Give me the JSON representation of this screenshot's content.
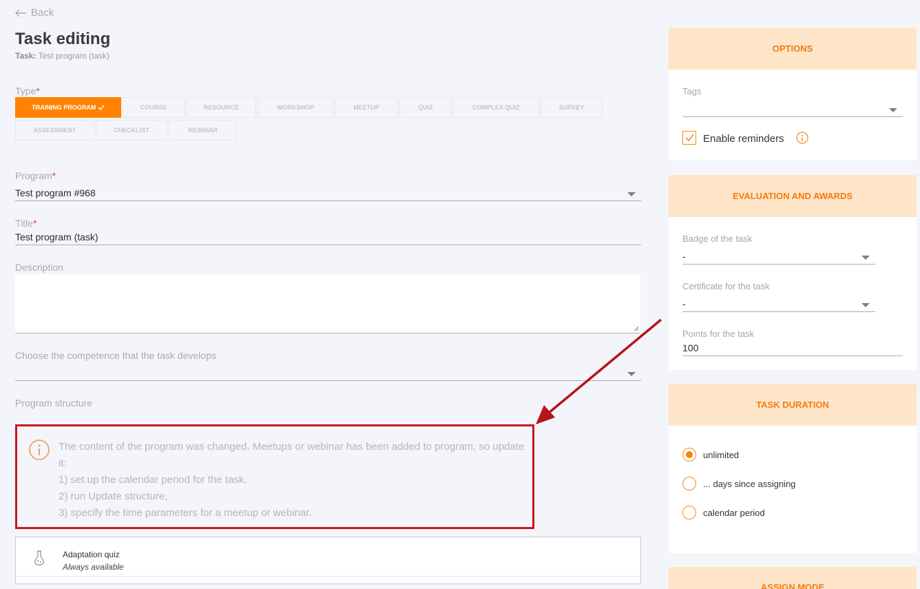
{
  "nav": {
    "back_label": "Back"
  },
  "header": {
    "title": "Task editing",
    "task_prefix": "Task:",
    "task_name": "Test program (task)"
  },
  "type_field": {
    "label": "Type",
    "options": [
      "TRAINING PROGRAM",
      "COURSE",
      "RESOURCE",
      "WORKSHOP",
      "MEETUP",
      "QUIZ",
      "COMPLEX QUIZ",
      "SURVEY",
      "ASSESSMENT",
      "CHECKLIST",
      "WEBINAR"
    ],
    "selected": "TRAINING PROGRAM"
  },
  "program_field": {
    "label": "Program",
    "value": "Test program #968"
  },
  "title_field": {
    "label": "Title",
    "value": "Test program (task)"
  },
  "description_field": {
    "label": "Description",
    "value": ""
  },
  "competence_field": {
    "label": "Choose the competence that the task develops",
    "value": ""
  },
  "structure": {
    "label": "Program structure",
    "notice_lines": [
      "The content of the program was changed. Meetups or webinar has been added to program, so update it:",
      "1) set up the calendar period for the task,",
      "2) run Update structure,",
      "3) specify the time parameters for a meetup or webinar."
    ],
    "items": [
      {
        "name": "Adaptation quiz",
        "availability": "Always available",
        "icon": "flask-icon"
      }
    ]
  },
  "options_panel": {
    "title": "OPTIONS",
    "tags_label": "Tags",
    "tags_value": "",
    "reminders_label": "Enable reminders",
    "reminders_checked": true
  },
  "evaluation_panel": {
    "title": "EVALUATION AND AWARDS",
    "badge_label": "Badge of the task",
    "badge_value": "-",
    "certificate_label": "Certificate for the task",
    "certificate_value": "-",
    "points_label": "Points for the task",
    "points_value": "100"
  },
  "duration_panel": {
    "title": "TASK DURATION",
    "options": [
      "unlimited",
      "... days since assigning",
      "calendar period"
    ],
    "selected": "unlimited"
  },
  "assign_panel": {
    "title": "ASSIGN MODE"
  },
  "colors": {
    "accent": "#ff8200",
    "panel_header_bg": "#fee5c8",
    "annotation_red": "#c7181c"
  }
}
